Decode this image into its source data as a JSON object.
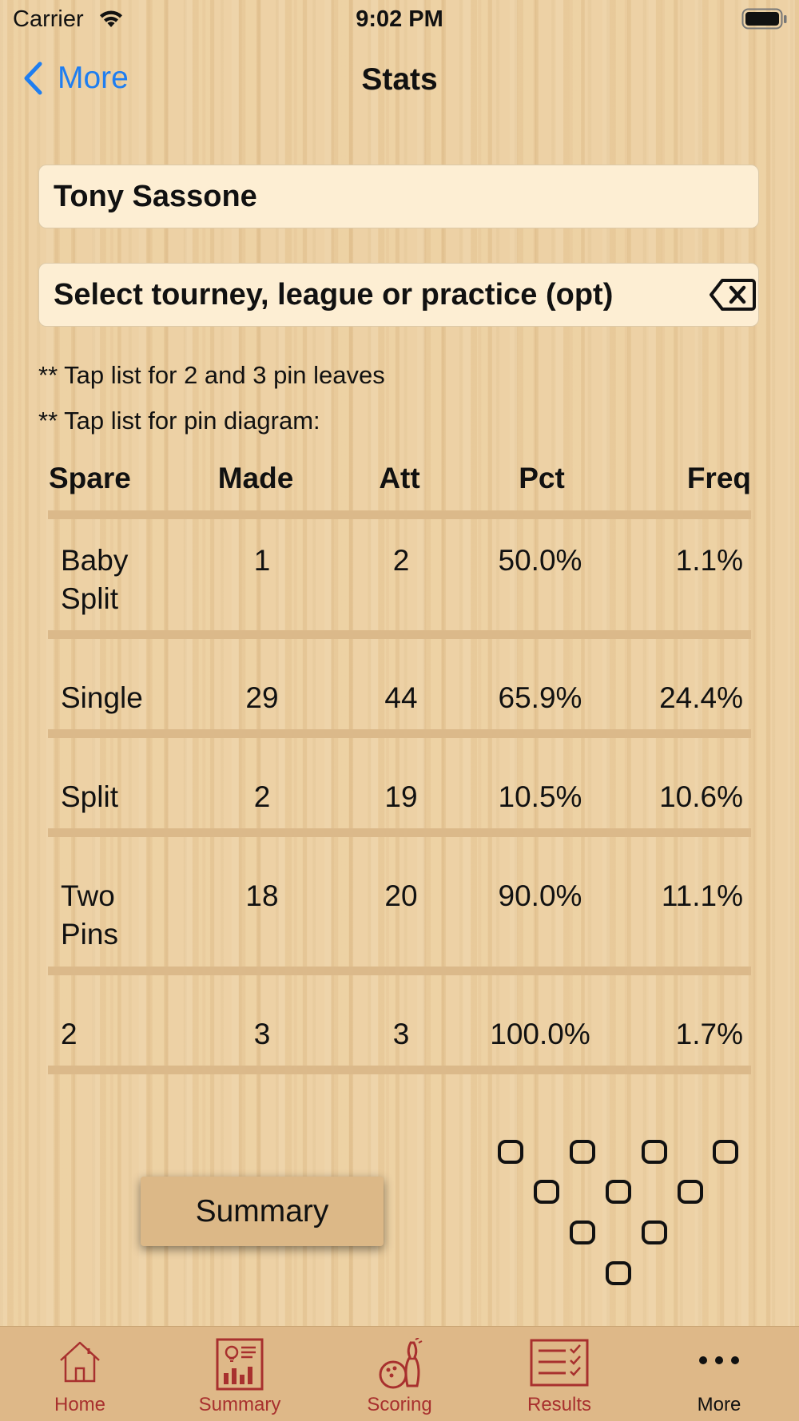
{
  "status_bar": {
    "carrier": "Carrier",
    "time": "9:02 PM"
  },
  "nav": {
    "back_label": "More",
    "title": "Stats"
  },
  "bowler_field": {
    "value": "Tony Sassone"
  },
  "event_field": {
    "value": "Select tourney, league or practice (opt)"
  },
  "hints": [
    "** Tap list for 2 and 3 pin leaves",
    "** Tap list for pin diagram:"
  ],
  "table": {
    "headers": [
      "Spare",
      "Made",
      "Att",
      "Pct",
      "Freq"
    ],
    "rows": [
      {
        "spare": "Baby\nSplit",
        "made": "1",
        "att": "2",
        "pct": "50.0%",
        "freq": "1.1%"
      },
      {
        "spare": "Single",
        "made": "29",
        "att": "44",
        "pct": "65.9%",
        "freq": "24.4%"
      },
      {
        "spare": "Split",
        "made": "2",
        "att": "19",
        "pct": "10.5%",
        "freq": "10.6%"
      },
      {
        "spare": "Two\nPins",
        "made": "18",
        "att": "20",
        "pct": "90.0%",
        "freq": "11.1%"
      },
      {
        "spare": "2",
        "made": "3",
        "att": "3",
        "pct": "100.0%",
        "freq": "1.7%"
      }
    ]
  },
  "summary_button": {
    "label": "Summary"
  },
  "pin_diagram": {
    "pins_standing": [],
    "pin_count": 10
  },
  "tab_bar": {
    "items": [
      {
        "label": "Home",
        "icon": "home-icon",
        "active": false
      },
      {
        "label": "Summary",
        "icon": "summary-report-icon",
        "active": false
      },
      {
        "label": "Scoring",
        "icon": "bowling-ball-pin-icon",
        "active": false
      },
      {
        "label": "Results",
        "icon": "checklist-icon",
        "active": false
      },
      {
        "label": "More",
        "icon": "more-dots-icon",
        "active": true
      }
    ]
  },
  "colors": {
    "accent_blue": "#1f7ef0",
    "tab_inactive": "#a8302e",
    "tab_bar_bg": "#deb888",
    "separator": "#dbb98a",
    "field_bg": "#fdeed3",
    "button_bg": "#dcb887"
  }
}
